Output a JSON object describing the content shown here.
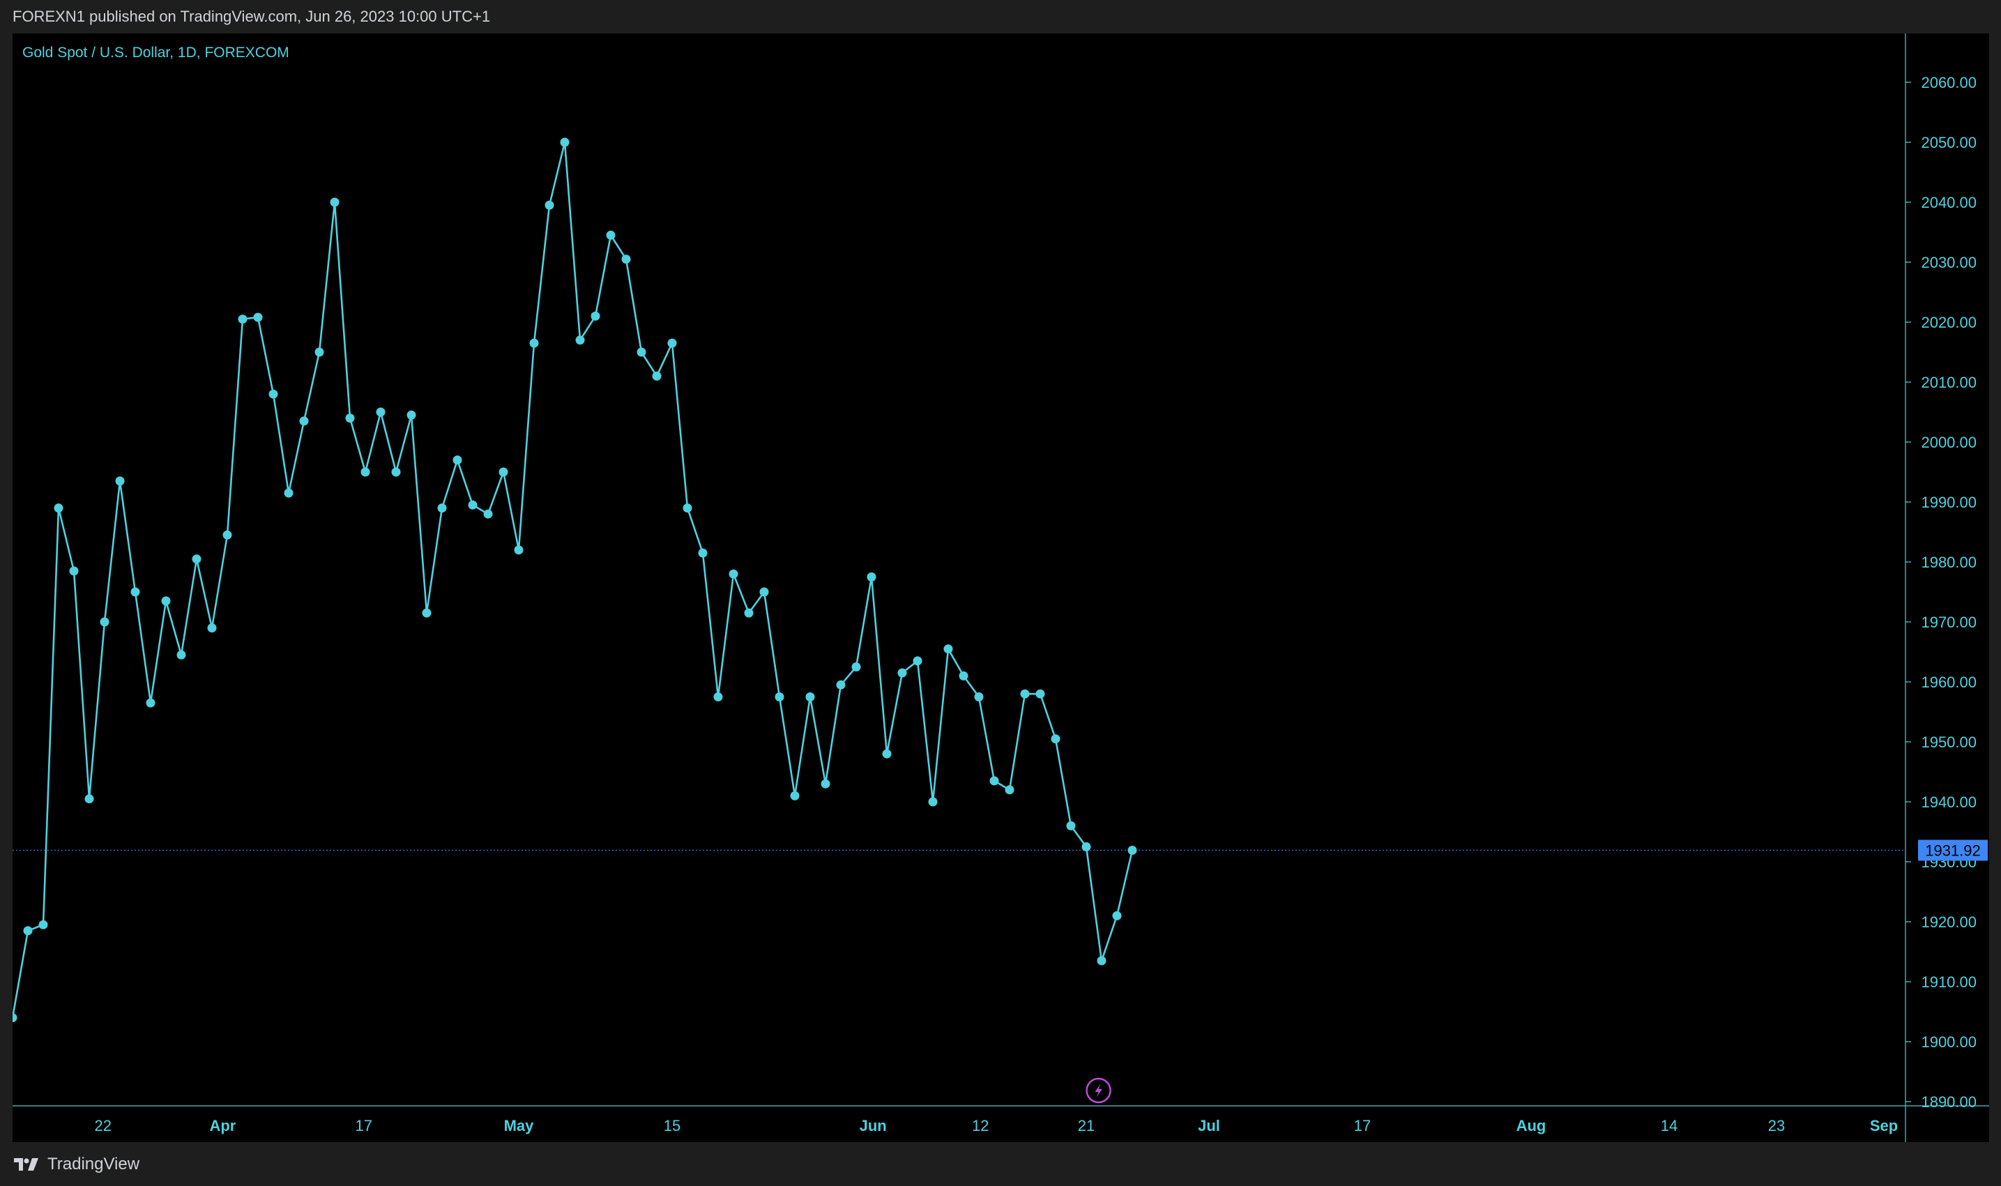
{
  "header": {
    "published": "FOREXN1 published on TradingView.com, Jun 26, 2023 10:00 UTC+1"
  },
  "footer": {
    "brand": "TradingView"
  },
  "colors": {
    "line": "#4fd1e0",
    "axis_text": "#4fd1e0",
    "background": "#000000",
    "price_tag_bg": "#3d86f5",
    "event_icon": "#c44ce0"
  },
  "icons": {
    "event": "lightning-icon"
  },
  "chart_data": {
    "type": "line",
    "title": "Gold Spot / U.S. Dollar, 1D, FOREXCOM",
    "series": [
      {
        "values": [
          1904,
          1918.5,
          1919.5,
          1989,
          1978.5,
          1940.5,
          1970,
          1993.5,
          1975,
          1956.5,
          1973.5,
          1964.5,
          1980.5,
          1969,
          1984.5,
          2020.5,
          2020.8,
          2008,
          1991.5,
          2003.5,
          2015,
          2040,
          2004,
          1995,
          2005,
          1995,
          2004.5,
          1971.5,
          1989,
          1997,
          1989.5,
          1988,
          1995,
          1982,
          2016.5,
          2039.5,
          2050,
          2017,
          2021,
          2034.5,
          2030.5,
          2015,
          2011,
          2016.5,
          1989,
          1981.5,
          1957.5,
          1978,
          1971.5,
          1975,
          1957.5,
          1941,
          1957.5,
          1943,
          1959.5,
          1962.5,
          1977.5,
          1948,
          1961.5,
          1963.5,
          1940,
          1965.5,
          1961,
          1957.5,
          1943.5,
          1942,
          1958,
          1958,
          1950.5,
          1936,
          1932.5,
          1913.5,
          1921,
          1931.92
        ]
      }
    ],
    "last_value": "1931.92",
    "y_ticks": [
      "2060.00",
      "2050.00",
      "2040.00",
      "2030.00",
      "2020.00",
      "2010.00",
      "2000.00",
      "1990.00",
      "1980.00",
      "1970.00",
      "1960.00",
      "1950.00",
      "1940.00",
      "1930.00",
      "1920.00",
      "1910.00",
      "1900.00",
      "1890.00"
    ],
    "y_tick_values": [
      2060,
      2050,
      2040,
      2030,
      2020,
      2010,
      2000,
      1990,
      1980,
      1970,
      1960,
      1950,
      1940,
      1930,
      1920,
      1910,
      1900,
      1890
    ],
    "ylim": [
      1890,
      2068
    ],
    "x_ticks": [
      {
        "label": "22",
        "bar": 5.9,
        "bold": false
      },
      {
        "label": "Apr",
        "bar": 13.7,
        "bold": true
      },
      {
        "label": "17",
        "bar": 22.9,
        "bold": false
      },
      {
        "label": "May",
        "bar": 33.0,
        "bold": true
      },
      {
        "label": "15",
        "bar": 43.0,
        "bold": false
      },
      {
        "label": "Jun",
        "bar": 56.1,
        "bold": true
      },
      {
        "label": "12",
        "bar": 63.1,
        "bold": false
      },
      {
        "label": "21",
        "bar": 70.0,
        "bold": false
      },
      {
        "label": "Jul",
        "bar": 78.0,
        "bold": true
      },
      {
        "label": "17",
        "bar": 88.0,
        "bold": false
      },
      {
        "label": "Aug",
        "bar": 99.0,
        "bold": true
      },
      {
        "label": "14",
        "bar": 108.0,
        "bold": false
      },
      {
        "label": "23",
        "bar": 115.0,
        "bold": false
      },
      {
        "label": "Sep",
        "bar": 122.0,
        "bold": true
      }
    ],
    "event_marker_bar": 70.8,
    "grid": false,
    "legend": "none"
  }
}
